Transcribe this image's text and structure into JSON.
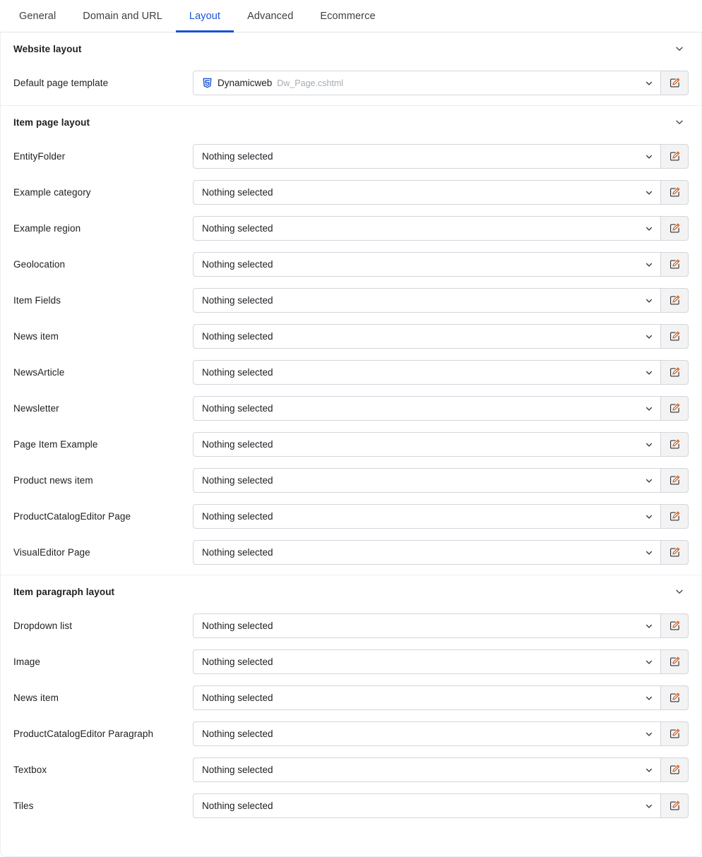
{
  "tabs": [
    {
      "label": "General",
      "active": false
    },
    {
      "label": "Domain and URL",
      "active": false
    },
    {
      "label": "Layout",
      "active": true
    },
    {
      "label": "Advanced",
      "active": false
    },
    {
      "label": "Ecommerce",
      "active": false
    }
  ],
  "colors": {
    "accent": "#1552d8",
    "active_tab_text": "#1a56d6",
    "text": "#202124",
    "muted": "#a6abb1",
    "border": "#d3d6da",
    "button_bg": "#f3f3f4",
    "icon_blue": "#1a56d6",
    "pencil_orange": "#d4540f"
  },
  "placeholder": "Nothing selected",
  "sections": [
    {
      "title": "Website layout",
      "collapse_icon": "chevron-down-icon",
      "rows": [
        {
          "label": "Default page template",
          "value": "Dynamicweb",
          "sub_value": "Dw_Page.cshtml",
          "icon": "dynamicweb-template-icon",
          "has_icon": true,
          "edit_icon": "edit-pencil-icon"
        }
      ]
    },
    {
      "title": "Item page layout",
      "collapse_icon": "chevron-down-icon",
      "rows": [
        {
          "label": "EntityFolder",
          "value": "Nothing selected",
          "has_icon": false,
          "edit_icon": "edit-pencil-icon"
        },
        {
          "label": "Example category",
          "value": "Nothing selected",
          "has_icon": false,
          "edit_icon": "edit-pencil-icon"
        },
        {
          "label": "Example region",
          "value": "Nothing selected",
          "has_icon": false,
          "edit_icon": "edit-pencil-icon"
        },
        {
          "label": "Geolocation",
          "value": "Nothing selected",
          "has_icon": false,
          "edit_icon": "edit-pencil-icon"
        },
        {
          "label": "Item Fields",
          "value": "Nothing selected",
          "has_icon": false,
          "edit_icon": "edit-pencil-icon"
        },
        {
          "label": "News item",
          "value": "Nothing selected",
          "has_icon": false,
          "edit_icon": "edit-pencil-icon"
        },
        {
          "label": "NewsArticle",
          "value": "Nothing selected",
          "has_icon": false,
          "edit_icon": "edit-pencil-icon"
        },
        {
          "label": "Newsletter",
          "value": "Nothing selected",
          "has_icon": false,
          "edit_icon": "edit-pencil-icon"
        },
        {
          "label": "Page Item Example",
          "value": "Nothing selected",
          "has_icon": false,
          "edit_icon": "edit-pencil-icon"
        },
        {
          "label": "Product news item",
          "value": "Nothing selected",
          "has_icon": false,
          "edit_icon": "edit-pencil-icon"
        },
        {
          "label": "ProductCatalogEditor Page",
          "value": "Nothing selected",
          "has_icon": false,
          "edit_icon": "edit-pencil-icon"
        },
        {
          "label": "VisualEditor Page",
          "value": "Nothing selected",
          "has_icon": false,
          "edit_icon": "edit-pencil-icon"
        }
      ]
    },
    {
      "title": "Item paragraph layout",
      "collapse_icon": "chevron-down-icon",
      "rows": [
        {
          "label": "Dropdown list",
          "value": "Nothing selected",
          "has_icon": false,
          "edit_icon": "edit-pencil-icon"
        },
        {
          "label": "Image",
          "value": "Nothing selected",
          "has_icon": false,
          "edit_icon": "edit-pencil-icon"
        },
        {
          "label": "News item",
          "value": "Nothing selected",
          "has_icon": false,
          "edit_icon": "edit-pencil-icon"
        },
        {
          "label": "ProductCatalogEditor Paragraph",
          "value": "Nothing selected",
          "has_icon": false,
          "edit_icon": "edit-pencil-icon"
        },
        {
          "label": "Textbox",
          "value": "Nothing selected",
          "has_icon": false,
          "edit_icon": "edit-pencil-icon"
        },
        {
          "label": "Tiles",
          "value": "Nothing selected",
          "has_icon": false,
          "edit_icon": "edit-pencil-icon"
        }
      ]
    }
  ]
}
